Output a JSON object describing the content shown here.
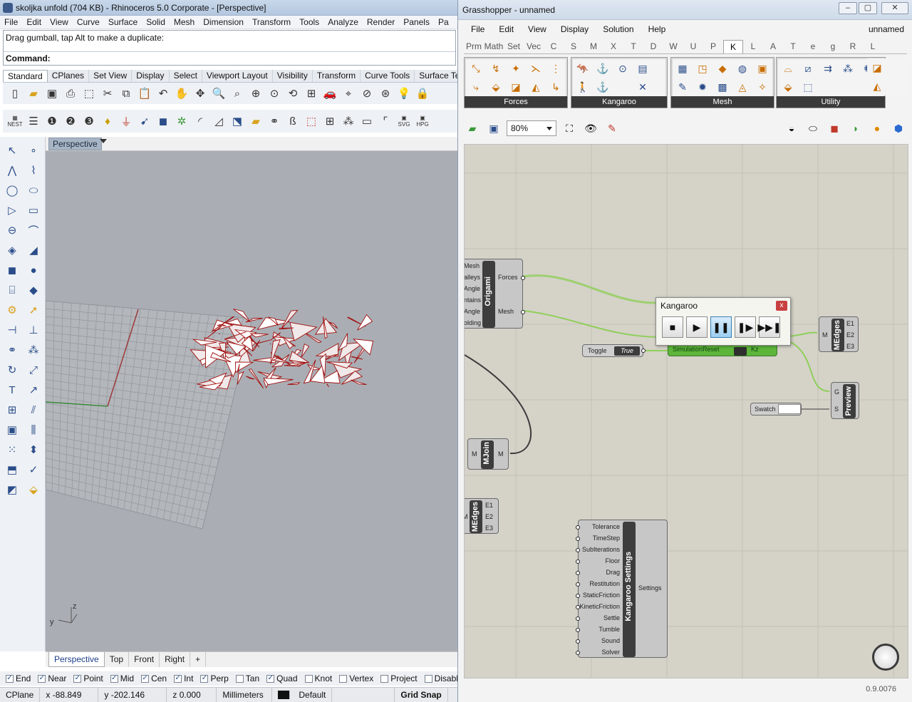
{
  "rhino": {
    "title": "skoljka unfold (704 KB) - Rhinoceros  5.0 Corporate - [Perspective]",
    "menu": [
      "File",
      "Edit",
      "View",
      "Curve",
      "Surface",
      "Solid",
      "Mesh",
      "Dimension",
      "Transform",
      "Tools",
      "Analyze",
      "Render",
      "Panels",
      "Pa"
    ],
    "command_history": "Drag gumball, tap Alt to make a duplicate:",
    "command_label": "Command:",
    "toolbar_tabs": [
      "Standard",
      "CPlanes",
      "Set View",
      "Display",
      "Select",
      "Viewport Layout",
      "Visibility",
      "Transform",
      "Curve Tools",
      "Surface Te"
    ],
    "toolbar_row2_labels": {
      "nest": "NEST",
      "svg": "SVG",
      "hp": "HPG"
    },
    "viewport_label": "Perspective",
    "viewport_tabs": [
      "Perspective",
      "Top",
      "Front",
      "Right",
      "+"
    ],
    "osnaps": [
      {
        "label": "End",
        "checked": true
      },
      {
        "label": "Near",
        "checked": true
      },
      {
        "label": "Point",
        "checked": true
      },
      {
        "label": "Mid",
        "checked": true
      },
      {
        "label": "Cen",
        "checked": true
      },
      {
        "label": "Int",
        "checked": true
      },
      {
        "label": "Perp",
        "checked": true
      },
      {
        "label": "Tan",
        "checked": false
      },
      {
        "label": "Quad",
        "checked": true
      },
      {
        "label": "Knot",
        "checked": false
      },
      {
        "label": "Vertex",
        "checked": false
      },
      {
        "label": "Project",
        "checked": false
      },
      {
        "label": "Disable",
        "checked": false
      }
    ],
    "status": {
      "cplane": "CPlane",
      "x": "x -88.849",
      "y": "y -202.146",
      "z": "z 0.000",
      "units": "Millimeters",
      "layer": "Default",
      "gridsnap": "Grid Snap"
    },
    "axis_labels": {
      "y": "y",
      "z": "z"
    }
  },
  "gh": {
    "title": "Grasshopper - unnamed",
    "menu": [
      "File",
      "Edit",
      "View",
      "Display",
      "Solution",
      "Help"
    ],
    "doc_name": "unnamed",
    "categories": [
      "Prm",
      "Math",
      "Set",
      "Vec",
      "C",
      "S",
      "M",
      "X",
      "T",
      "D",
      "W",
      "U",
      "P",
      "K",
      "L",
      "A",
      "T",
      "e",
      "g",
      "R",
      "L"
    ],
    "active_category": "K",
    "groups": [
      "Forces",
      "Kangaroo",
      "Mesh",
      "Utility"
    ],
    "zoom": "80%",
    "version": "0.9.0076",
    "origami": {
      "inputs": [
        "Mesh",
        "alleys",
        "Angle",
        "ntains",
        "Angle",
        "olding"
      ],
      "name": "Origami",
      "outputs": [
        "Forces",
        "Mesh"
      ]
    },
    "kangaroo": {
      "title": "Kangaroo",
      "close": "x",
      "buttons": [
        "stop",
        "play",
        "pause",
        "step",
        "end"
      ],
      "under_label": "SimulationReset",
      "under_right": "Kz"
    },
    "toggle": {
      "label": "Toggle",
      "value": "True"
    },
    "medges1": {
      "input": "M",
      "name": "MEdges",
      "outputs": [
        "E1",
        "E2",
        "E3"
      ]
    },
    "preview": {
      "inputs": [
        "G",
        "S"
      ],
      "name": "Preview"
    },
    "swatch": {
      "label": "Swatch"
    },
    "mjoin": {
      "input": "M",
      "name": "MJoin",
      "output": "M"
    },
    "medges2": {
      "input": "M",
      "name": "MEdges",
      "outputs": [
        "E1",
        "E2",
        "E3"
      ]
    },
    "settings": {
      "inputs": [
        "Tolerance",
        "TimeStep",
        "SubIterations",
        "Floor",
        "Drag",
        "Restitution",
        "StaticFriction",
        "KineticFriction",
        "Settle",
        "Tumble",
        "Sound",
        "Solver"
      ],
      "name": "Kangaroo Settings",
      "output": "Settings"
    }
  },
  "colors": {
    "mesh": "#a01010",
    "wire_green": "#8fcf5a",
    "wire_dark": "#3b3b3b",
    "accent": "#3c7fb1"
  }
}
